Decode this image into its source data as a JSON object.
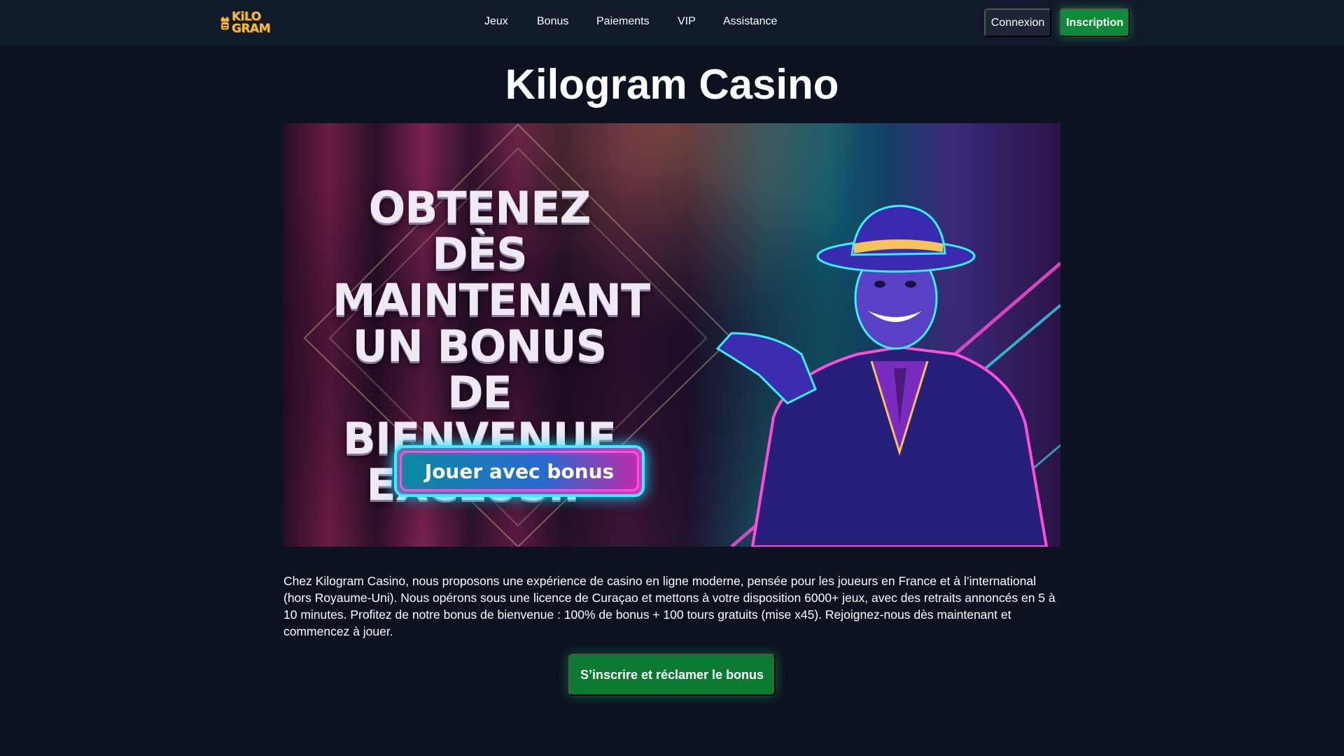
{
  "brand": {
    "logo_line1": "KiLO",
    "logo_line2": "GRAM",
    "accent": "#f6b93b"
  },
  "nav": {
    "items": [
      {
        "label": "Jeux"
      },
      {
        "label": "Bonus"
      },
      {
        "label": "Paiements"
      },
      {
        "label": "VIP"
      },
      {
        "label": "Assistance"
      }
    ],
    "login_label": "Connexion",
    "signup_label": "Inscription"
  },
  "main": {
    "title": "Kilogram Casino",
    "hero": {
      "headline_lines": [
        "OBTENEZ DÈS",
        "MAINTENANT",
        "UN BONUS DE",
        "BIENVENUE",
        "EXCLUSIF"
      ],
      "cta_label": "Jouer avec bonus"
    },
    "intro_text": "Chez Kilogram Casino, nous proposons une expérience de casino en ligne moderne, pensée pour les joueurs en France et à l’international (hors Royaume-Uni). Nous opérons sous une licence de Curaçao et mettons à votre disposition 6000+ jeux, avec des retraits annoncés en 5 à 10 minutes. Profitez de notre bonus de bienvenue : 100% de bonus + 100 tours gratuits (mise x45). Rejoignez-nous dès maintenant et commencez à jouer.",
    "claim_label": "S’inscrire et réclamer le bonus"
  },
  "colors": {
    "background": "#0b1220",
    "header": "#111a2b",
    "primary_green": "#0f8a3a",
    "neon_cyan": "#35f0ff",
    "neon_pink": "#ff4fd8"
  }
}
